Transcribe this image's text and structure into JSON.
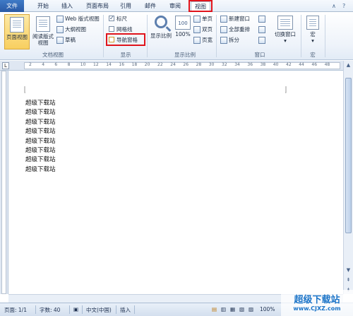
{
  "tabs": [
    "文件",
    "开始",
    "插入",
    "页面布局",
    "引用",
    "邮件",
    "审阅",
    "视图"
  ],
  "ribbon": {
    "doc_views": {
      "print_layout": "页面视图",
      "reading_layout": "阅读版式\n视图",
      "web_layout": "Web 版式视图",
      "outline": "大纲视图",
      "draft": "草稿",
      "label": "文档视图"
    },
    "show": {
      "ruler": "标尺",
      "gridlines": "网格线",
      "nav_pane": "导航窗格",
      "label": "显示",
      "ruler_checked": true,
      "gridlines_checked": false,
      "nav_pane_checked": false
    },
    "zoom": {
      "zoom": "显示比例",
      "percent": "100%",
      "one_page": "单页",
      "two_pages": "双页",
      "page_width": "页宽",
      "label": "显示比例"
    },
    "window": {
      "new_window": "新建窗口",
      "arrange_all": "全部重排",
      "split": "拆分",
      "switch_windows": "切换窗口",
      "label": "窗口"
    },
    "macros": {
      "macros": "宏",
      "label": "宏"
    }
  },
  "ruler_ticks": [
    "2",
    "4",
    "6",
    "8",
    "10",
    "12",
    "14",
    "16",
    "18",
    "20",
    "22",
    "24",
    "26",
    "28",
    "30",
    "32",
    "34",
    "36",
    "38",
    "40",
    "42",
    "44",
    "46",
    "48"
  ],
  "document": {
    "lines": [
      "超级下载站",
      "超级下载站",
      "超级下载站",
      "超级下载站",
      "超级下载站",
      "超级下载站",
      "超级下载站",
      "超级下载站"
    ]
  },
  "status": {
    "page": "页面: 1/1",
    "words": "字数: 40",
    "language": "中文(中国)",
    "mode": "插入",
    "zoom": "100%"
  },
  "watermark": {
    "title": "超级下载站",
    "url": "www.CJXZ.com"
  },
  "colors": {
    "file_tab": "#2a5aa6",
    "highlight_box": "#e0141c",
    "selected_button": "#f8cf60"
  }
}
